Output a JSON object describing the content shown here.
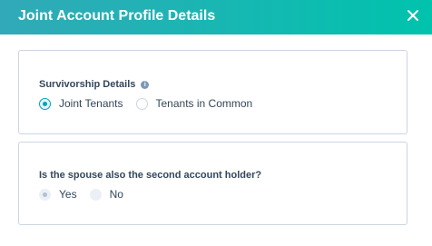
{
  "modal": {
    "title": "Joint Account Profile Details",
    "close_icon": "close-icon"
  },
  "survivorship": {
    "label": "Survivorship Details",
    "info_icon": "info-icon",
    "options": [
      {
        "label": "Joint Tenants",
        "selected": true
      },
      {
        "label": "Tenants in Common",
        "selected": false
      }
    ]
  },
  "spouse": {
    "label": "Is the spouse also the second account holder?",
    "options": [
      {
        "label": "Yes",
        "selected": true,
        "disabled": true
      },
      {
        "label": "No",
        "selected": false,
        "disabled": true
      }
    ]
  },
  "colors": {
    "header_start": "#32a9b8",
    "header_end": "#00c3ad",
    "accent": "#00a4bd"
  }
}
